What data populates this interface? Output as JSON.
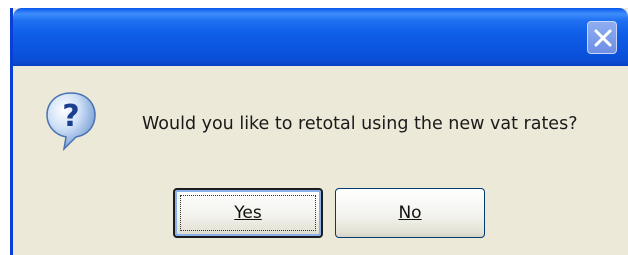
{
  "dialog": {
    "title": "",
    "message": "Would you like to retotal using the new vat rates?",
    "icon": "question-icon",
    "close_icon": "close-icon",
    "buttons": {
      "yes_label": "Yes",
      "no_label": "No"
    },
    "default_button": "Yes"
  },
  "colors": {
    "titlebar": "#0b55e0",
    "dialog_bg": "#ece9d8",
    "button_border": "#003c74"
  }
}
